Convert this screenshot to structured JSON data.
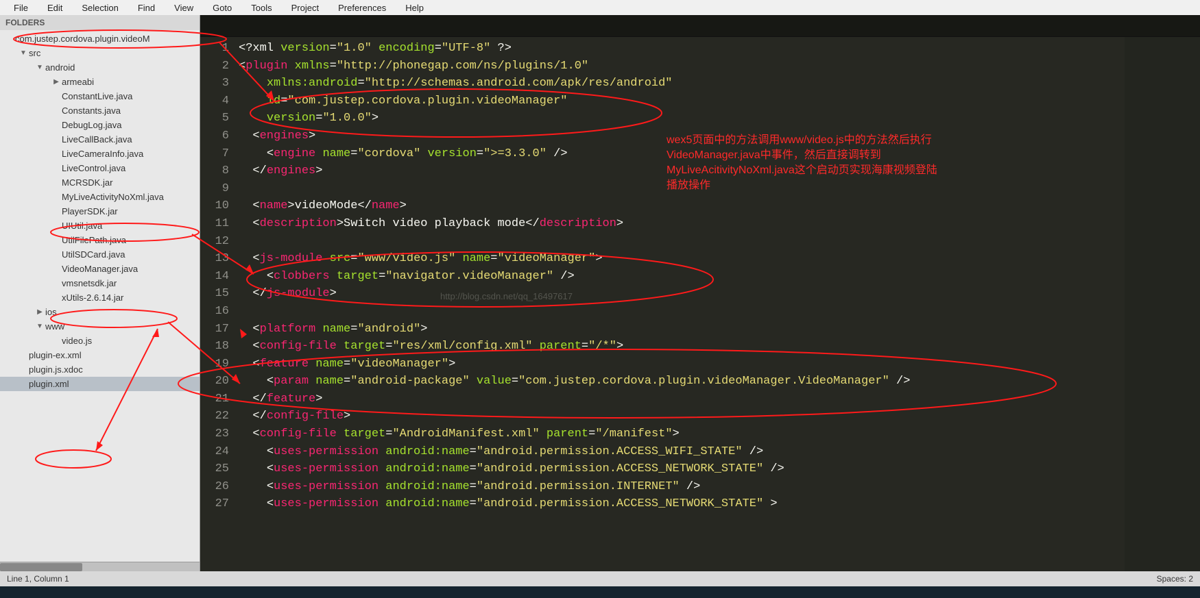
{
  "menu": [
    "File",
    "Edit",
    "Selection",
    "Find",
    "View",
    "Goto",
    "Tools",
    "Project",
    "Preferences",
    "Help"
  ],
  "sidebar": {
    "header": "FOLDERS",
    "rows": [
      {
        "depth": 0,
        "arrow": "",
        "label": "com.justep.cordova.plugin.videoM"
      },
      {
        "depth": 1,
        "arrow": "▼",
        "label": "src"
      },
      {
        "depth": 2,
        "arrow": "▼",
        "label": "android"
      },
      {
        "depth": 3,
        "arrow": "▶",
        "label": "armeabi"
      },
      {
        "depth": 3,
        "arrow": "",
        "label": "ConstantLive.java"
      },
      {
        "depth": 3,
        "arrow": "",
        "label": "Constants.java"
      },
      {
        "depth": 3,
        "arrow": "",
        "label": "DebugLog.java"
      },
      {
        "depth": 3,
        "arrow": "",
        "label": "LiveCallBack.java"
      },
      {
        "depth": 3,
        "arrow": "",
        "label": "LiveCameraInfo.java"
      },
      {
        "depth": 3,
        "arrow": "",
        "label": "LiveControl.java"
      },
      {
        "depth": 3,
        "arrow": "",
        "label": "MCRSDK.jar"
      },
      {
        "depth": 3,
        "arrow": "",
        "label": "MyLiveActivityNoXml.java"
      },
      {
        "depth": 3,
        "arrow": "",
        "label": "PlayerSDK.jar"
      },
      {
        "depth": 3,
        "arrow": "",
        "label": "UIUtil.java"
      },
      {
        "depth": 3,
        "arrow": "",
        "label": "UtilFilePath.java"
      },
      {
        "depth": 3,
        "arrow": "",
        "label": "UtilSDCard.java"
      },
      {
        "depth": 3,
        "arrow": "",
        "label": "VideoManager.java"
      },
      {
        "depth": 3,
        "arrow": "",
        "label": "vmsnetsdk.jar"
      },
      {
        "depth": 3,
        "arrow": "",
        "label": "xUtils-2.6.14.jar"
      },
      {
        "depth": 2,
        "arrow": "▶",
        "label": "ios"
      },
      {
        "depth": 2,
        "arrow": "▼",
        "label": "www"
      },
      {
        "depth": 3,
        "arrow": "",
        "label": "video.js"
      },
      {
        "depth": 1,
        "arrow": "",
        "label": "plugin-ex.xml"
      },
      {
        "depth": 1,
        "arrow": "",
        "label": "plugin.js.xdoc"
      },
      {
        "depth": 1,
        "arrow": "",
        "label": "plugin.xml",
        "selected": true
      }
    ]
  },
  "code": [
    [
      {
        "t": "pi",
        "v": "<?xml "
      },
      {
        "t": "attr",
        "v": "version"
      },
      {
        "t": "pun",
        "v": "="
      },
      {
        "t": "str",
        "v": "\"1.0\""
      },
      {
        "t": "pi",
        "v": " "
      },
      {
        "t": "attr",
        "v": "encoding"
      },
      {
        "t": "pun",
        "v": "="
      },
      {
        "t": "str",
        "v": "\"UTF-8\""
      },
      {
        "t": "pi",
        "v": " ?>"
      }
    ],
    [
      {
        "t": "pun",
        "v": "<"
      },
      {
        "t": "tag",
        "v": "plugin"
      },
      {
        "t": "txt",
        "v": " "
      },
      {
        "t": "attr",
        "v": "xmlns"
      },
      {
        "t": "pun",
        "v": "="
      },
      {
        "t": "str",
        "v": "\"http://phonegap.com/ns/plugins/1.0\""
      }
    ],
    [
      {
        "t": "txt",
        "v": "    "
      },
      {
        "t": "attr",
        "v": "xmlns:android"
      },
      {
        "t": "pun",
        "v": "="
      },
      {
        "t": "str",
        "v": "\"http://schemas.android.com/apk/res/android\""
      }
    ],
    [
      {
        "t": "txt",
        "v": "    "
      },
      {
        "t": "attr",
        "v": "id"
      },
      {
        "t": "pun",
        "v": "="
      },
      {
        "t": "str",
        "v": "\"com.justep.cordova.plugin.videoManager\""
      }
    ],
    [
      {
        "t": "txt",
        "v": "    "
      },
      {
        "t": "attr",
        "v": "version"
      },
      {
        "t": "pun",
        "v": "="
      },
      {
        "t": "str",
        "v": "\"1.0.0\""
      },
      {
        "t": "pun",
        "v": ">"
      }
    ],
    [
      {
        "t": "txt",
        "v": "  "
      },
      {
        "t": "pun",
        "v": "<"
      },
      {
        "t": "tag",
        "v": "engines"
      },
      {
        "t": "pun",
        "v": ">"
      }
    ],
    [
      {
        "t": "txt",
        "v": "    "
      },
      {
        "t": "pun",
        "v": "<"
      },
      {
        "t": "tag",
        "v": "engine"
      },
      {
        "t": "txt",
        "v": " "
      },
      {
        "t": "attr",
        "v": "name"
      },
      {
        "t": "pun",
        "v": "="
      },
      {
        "t": "str",
        "v": "\"cordova\""
      },
      {
        "t": "txt",
        "v": " "
      },
      {
        "t": "attr",
        "v": "version"
      },
      {
        "t": "pun",
        "v": "="
      },
      {
        "t": "str",
        "v": "\">=3.3.0\""
      },
      {
        "t": "pun",
        "v": " />"
      }
    ],
    [
      {
        "t": "txt",
        "v": "  "
      },
      {
        "t": "pun",
        "v": "</"
      },
      {
        "t": "tag",
        "v": "engines"
      },
      {
        "t": "pun",
        "v": ">"
      }
    ],
    [],
    [
      {
        "t": "txt",
        "v": "  "
      },
      {
        "t": "pun",
        "v": "<"
      },
      {
        "t": "tag",
        "v": "name"
      },
      {
        "t": "pun",
        "v": ">"
      },
      {
        "t": "txt",
        "v": "videoMode"
      },
      {
        "t": "pun",
        "v": "</"
      },
      {
        "t": "tag",
        "v": "name"
      },
      {
        "t": "pun",
        "v": ">"
      }
    ],
    [
      {
        "t": "txt",
        "v": "  "
      },
      {
        "t": "pun",
        "v": "<"
      },
      {
        "t": "tag",
        "v": "description"
      },
      {
        "t": "pun",
        "v": ">"
      },
      {
        "t": "txt",
        "v": "Switch video playback mode"
      },
      {
        "t": "pun",
        "v": "</"
      },
      {
        "t": "tag",
        "v": "description"
      },
      {
        "t": "pun",
        "v": ">"
      }
    ],
    [],
    [
      {
        "t": "txt",
        "v": "  "
      },
      {
        "t": "pun",
        "v": "<"
      },
      {
        "t": "tag",
        "v": "js-module"
      },
      {
        "t": "txt",
        "v": " "
      },
      {
        "t": "attr",
        "v": "src"
      },
      {
        "t": "pun",
        "v": "="
      },
      {
        "t": "str",
        "v": "\"www/video.js\""
      },
      {
        "t": "txt",
        "v": " "
      },
      {
        "t": "attr",
        "v": "name"
      },
      {
        "t": "pun",
        "v": "="
      },
      {
        "t": "str",
        "v": "\"videoManager\""
      },
      {
        "t": "pun",
        "v": ">"
      }
    ],
    [
      {
        "t": "txt",
        "v": "    "
      },
      {
        "t": "pun",
        "v": "<"
      },
      {
        "t": "tag",
        "v": "clobbers"
      },
      {
        "t": "txt",
        "v": " "
      },
      {
        "t": "attr",
        "v": "target"
      },
      {
        "t": "pun",
        "v": "="
      },
      {
        "t": "str",
        "v": "\"navigator.videoManager\""
      },
      {
        "t": "pun",
        "v": " />"
      }
    ],
    [
      {
        "t": "txt",
        "v": "  "
      },
      {
        "t": "pun",
        "v": "</"
      },
      {
        "t": "tag",
        "v": "js-module"
      },
      {
        "t": "pun",
        "v": ">"
      }
    ],
    [],
    [
      {
        "t": "txt",
        "v": "  "
      },
      {
        "t": "pun",
        "v": "<"
      },
      {
        "t": "tag",
        "v": "platform"
      },
      {
        "t": "txt",
        "v": " "
      },
      {
        "t": "attr",
        "v": "name"
      },
      {
        "t": "pun",
        "v": "="
      },
      {
        "t": "str",
        "v": "\"android\""
      },
      {
        "t": "pun",
        "v": ">"
      }
    ],
    [
      {
        "t": "txt",
        "v": "  "
      },
      {
        "t": "pun",
        "v": "<"
      },
      {
        "t": "tag",
        "v": "config-file"
      },
      {
        "t": "txt",
        "v": " "
      },
      {
        "t": "attr",
        "v": "target"
      },
      {
        "t": "pun",
        "v": "="
      },
      {
        "t": "str",
        "v": "\"res/xml/config.xml\""
      },
      {
        "t": "txt",
        "v": " "
      },
      {
        "t": "attr",
        "v": "parent"
      },
      {
        "t": "pun",
        "v": "="
      },
      {
        "t": "str",
        "v": "\"/*\""
      },
      {
        "t": "pun",
        "v": ">"
      }
    ],
    [
      {
        "t": "txt",
        "v": "  "
      },
      {
        "t": "pun",
        "v": "<"
      },
      {
        "t": "tag",
        "v": "feature"
      },
      {
        "t": "txt",
        "v": " "
      },
      {
        "t": "attr",
        "v": "name"
      },
      {
        "t": "pun",
        "v": "="
      },
      {
        "t": "str",
        "v": "\"videoManager\""
      },
      {
        "t": "pun",
        "v": ">"
      }
    ],
    [
      {
        "t": "txt",
        "v": "    "
      },
      {
        "t": "pun",
        "v": "<"
      },
      {
        "t": "tag",
        "v": "param"
      },
      {
        "t": "txt",
        "v": " "
      },
      {
        "t": "attr",
        "v": "name"
      },
      {
        "t": "pun",
        "v": "="
      },
      {
        "t": "str",
        "v": "\"android-package\""
      },
      {
        "t": "txt",
        "v": " "
      },
      {
        "t": "attr",
        "v": "value"
      },
      {
        "t": "pun",
        "v": "="
      },
      {
        "t": "str",
        "v": "\"com.justep.cordova.plugin.videoManager.VideoManager\""
      },
      {
        "t": "pun",
        "v": " />"
      }
    ],
    [
      {
        "t": "txt",
        "v": "  "
      },
      {
        "t": "pun",
        "v": "</"
      },
      {
        "t": "tag",
        "v": "feature"
      },
      {
        "t": "pun",
        "v": ">"
      }
    ],
    [
      {
        "t": "txt",
        "v": "  "
      },
      {
        "t": "pun",
        "v": "</"
      },
      {
        "t": "tag",
        "v": "config-file"
      },
      {
        "t": "pun",
        "v": ">"
      }
    ],
    [
      {
        "t": "txt",
        "v": "  "
      },
      {
        "t": "pun",
        "v": "<"
      },
      {
        "t": "tag",
        "v": "config-file"
      },
      {
        "t": "txt",
        "v": " "
      },
      {
        "t": "attr",
        "v": "target"
      },
      {
        "t": "pun",
        "v": "="
      },
      {
        "t": "str",
        "v": "\"AndroidManifest.xml\""
      },
      {
        "t": "txt",
        "v": " "
      },
      {
        "t": "attr",
        "v": "parent"
      },
      {
        "t": "pun",
        "v": "="
      },
      {
        "t": "str",
        "v": "\"/manifest\""
      },
      {
        "t": "pun",
        "v": ">"
      }
    ],
    [
      {
        "t": "txt",
        "v": "    "
      },
      {
        "t": "pun",
        "v": "<"
      },
      {
        "t": "tag",
        "v": "uses-permission"
      },
      {
        "t": "txt",
        "v": " "
      },
      {
        "t": "attr",
        "v": "android:name"
      },
      {
        "t": "pun",
        "v": "="
      },
      {
        "t": "str",
        "v": "\"android.permission.ACCESS_WIFI_STATE\""
      },
      {
        "t": "pun",
        "v": " />"
      }
    ],
    [
      {
        "t": "txt",
        "v": "    "
      },
      {
        "t": "pun",
        "v": "<"
      },
      {
        "t": "tag",
        "v": "uses-permission"
      },
      {
        "t": "txt",
        "v": " "
      },
      {
        "t": "attr",
        "v": "android:name"
      },
      {
        "t": "pun",
        "v": "="
      },
      {
        "t": "str",
        "v": "\"android.permission.ACCESS_NETWORK_STATE\""
      },
      {
        "t": "pun",
        "v": " />"
      }
    ],
    [
      {
        "t": "txt",
        "v": "    "
      },
      {
        "t": "pun",
        "v": "<"
      },
      {
        "t": "tag",
        "v": "uses-permission"
      },
      {
        "t": "txt",
        "v": " "
      },
      {
        "t": "attr",
        "v": "android:name"
      },
      {
        "t": "pun",
        "v": "="
      },
      {
        "t": "str",
        "v": "\"android.permission.INTERNET\""
      },
      {
        "t": "pun",
        "v": " />"
      }
    ],
    [
      {
        "t": "txt",
        "v": "    "
      },
      {
        "t": "pun",
        "v": "<"
      },
      {
        "t": "tag",
        "v": "uses-permission"
      },
      {
        "t": "txt",
        "v": " "
      },
      {
        "t": "attr",
        "v": "android:name"
      },
      {
        "t": "pun",
        "v": "="
      },
      {
        "t": "str",
        "v": "\"android.permission.ACCESS_NETWORK_STATE\""
      },
      {
        "t": "pun",
        "v": " >"
      }
    ]
  ],
  "annotation": {
    "lines": [
      "wex5页面中的方法调用www/video.js中的方法然后执行",
      "VideoManager.java中事件，然后直接调转到",
      "MyLiveAcitivityNoXml.java这个启动页实现海康视频登陆",
      "播放操作"
    ]
  },
  "watermark": "http://blog.csdn.net/qq_16497617",
  "status": {
    "left": "Line 1, Column 1",
    "right": "Spaces: 2"
  }
}
